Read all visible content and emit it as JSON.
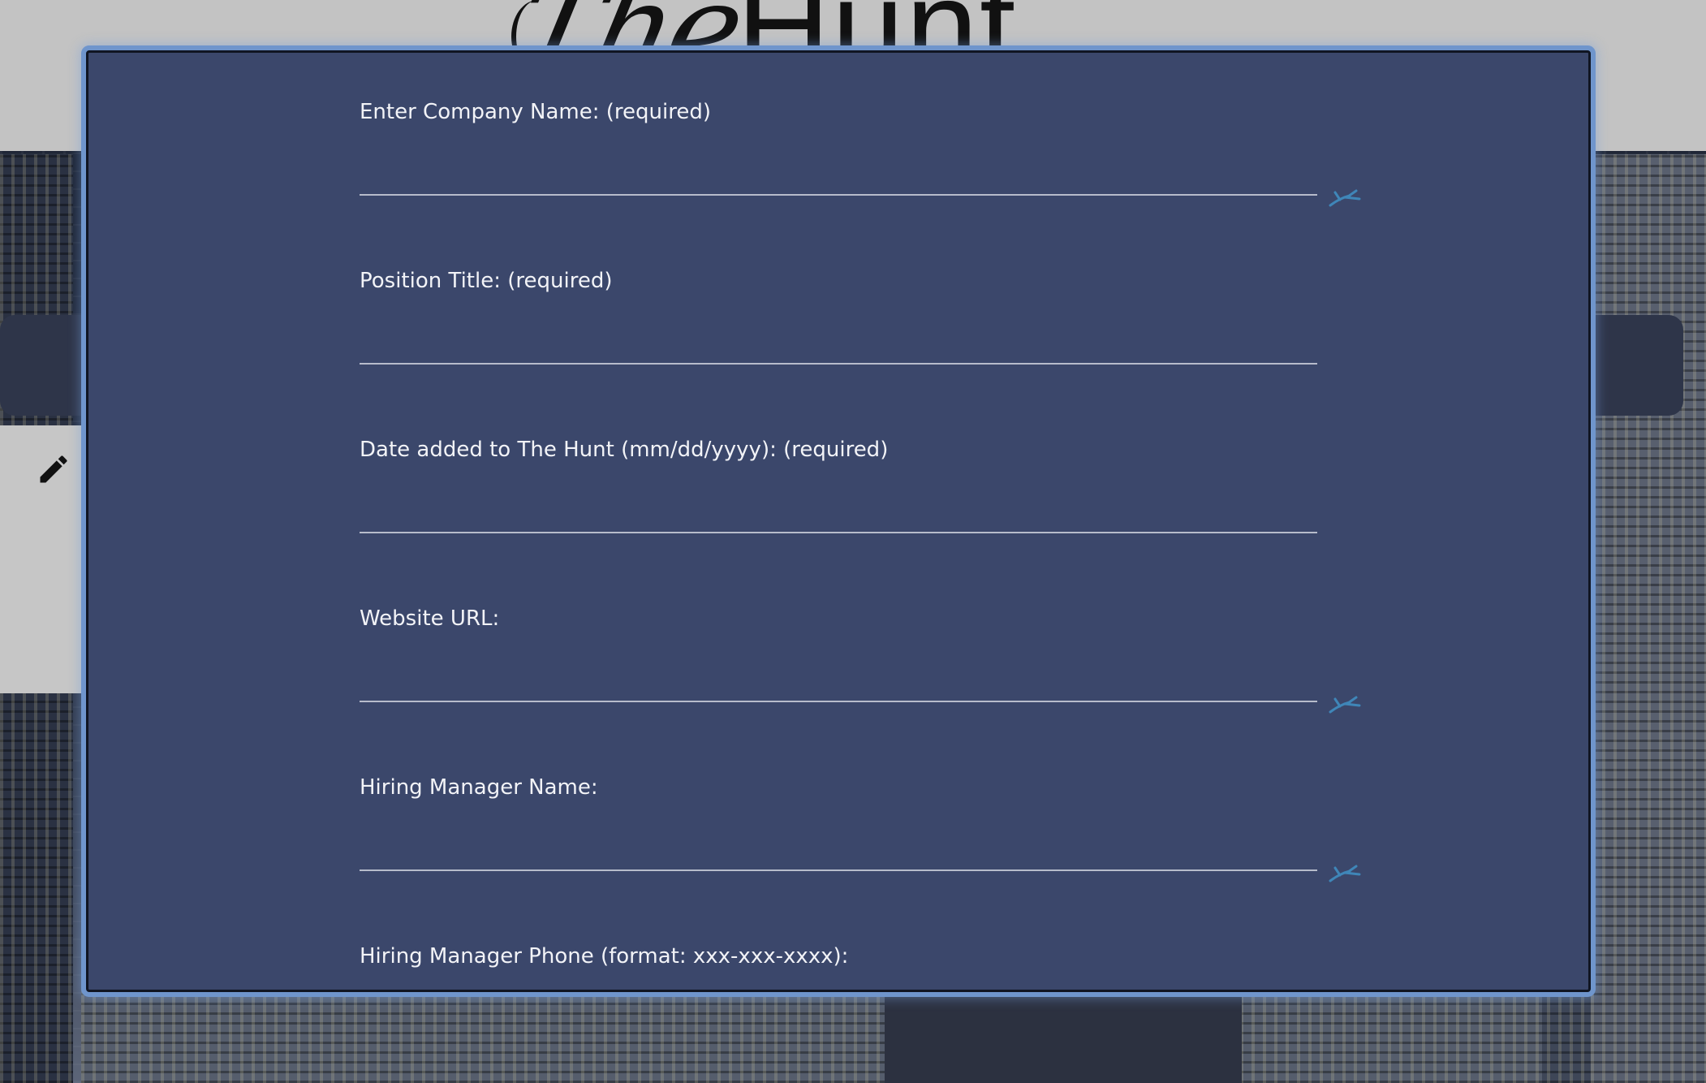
{
  "app": {
    "logo_script": "The",
    "logo_word": "Hunt"
  },
  "form": {
    "fields": [
      {
        "label": "Enter Company Name: (required)",
        "value": "",
        "autofill_icon": true
      },
      {
        "label": "Position Title: (required)",
        "value": "",
        "autofill_icon": false
      },
      {
        "label": "Date added to The Hunt (mm/dd/yyyy): (required)",
        "value": "",
        "autofill_icon": false
      },
      {
        "label": "Website URL:",
        "value": "",
        "autofill_icon": true
      },
      {
        "label": "Hiring Manager Name:",
        "value": "",
        "autofill_icon": true
      },
      {
        "label": "Hiring Manager Phone (format: xxx-xxx-xxxx):",
        "value": "",
        "autofill_icon": false
      }
    ]
  },
  "icons": {
    "background_card": "pencil-icon",
    "autofill": "password-manager-autofill-icon"
  },
  "colors": {
    "modal_bg": "#3b476b",
    "modal_glow": "#6f95cc",
    "label_text": "#f2f3f7",
    "autofill_icon": "#3f86b8"
  }
}
